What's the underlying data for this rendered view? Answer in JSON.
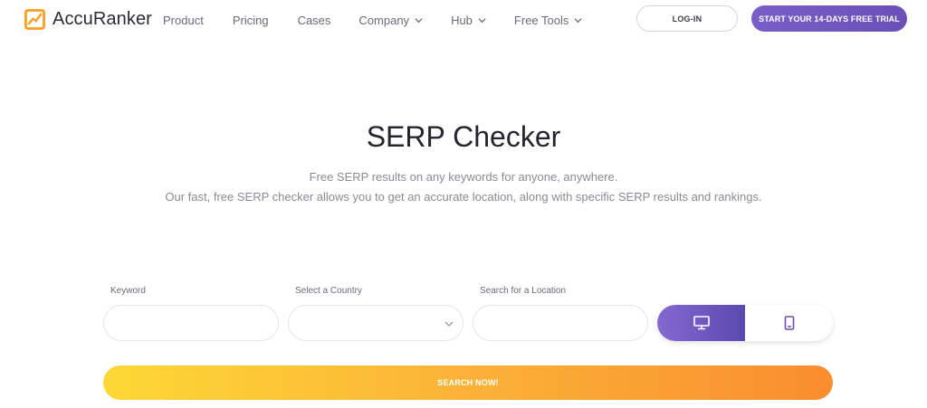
{
  "brand": {
    "name": "AccuRanker"
  },
  "nav": {
    "items": [
      {
        "label": "Product",
        "has_dropdown": false
      },
      {
        "label": "Pricing",
        "has_dropdown": false
      },
      {
        "label": "Cases",
        "has_dropdown": false
      },
      {
        "label": "Company",
        "has_dropdown": true
      },
      {
        "label": "Hub",
        "has_dropdown": true
      },
      {
        "label": "Free Tools",
        "has_dropdown": true
      }
    ],
    "login_label": "LOG-IN",
    "trial_label": "START YOUR 14-DAYS FREE TRIAL"
  },
  "hero": {
    "title": "SERP Checker",
    "subtitle_line1": "Free SERP results on any keywords for anyone, anywhere.",
    "subtitle_line2": "Our fast, free SERP checker allows you to get an accurate location, along with specific SERP results and rankings."
  },
  "form": {
    "keyword_label": "Keyword",
    "keyword_value": "",
    "country_label": "Select a Country",
    "country_value": "",
    "location_label": "Search for a Location",
    "location_value": "",
    "device_selected": "desktop",
    "search_label": "SEARCH NOW!"
  },
  "colors": {
    "accent_purple": "#6b4fb8",
    "search_gradient_start": "#fdd835",
    "search_gradient_end": "#f98d2f",
    "logo_orange": "#f7a32a"
  },
  "icons": {
    "logo": "accuranker-logo-icon",
    "desktop": "desktop-monitor-icon",
    "mobile": "mobile-phone-icon",
    "dropdown": "chevron-down-icon"
  }
}
